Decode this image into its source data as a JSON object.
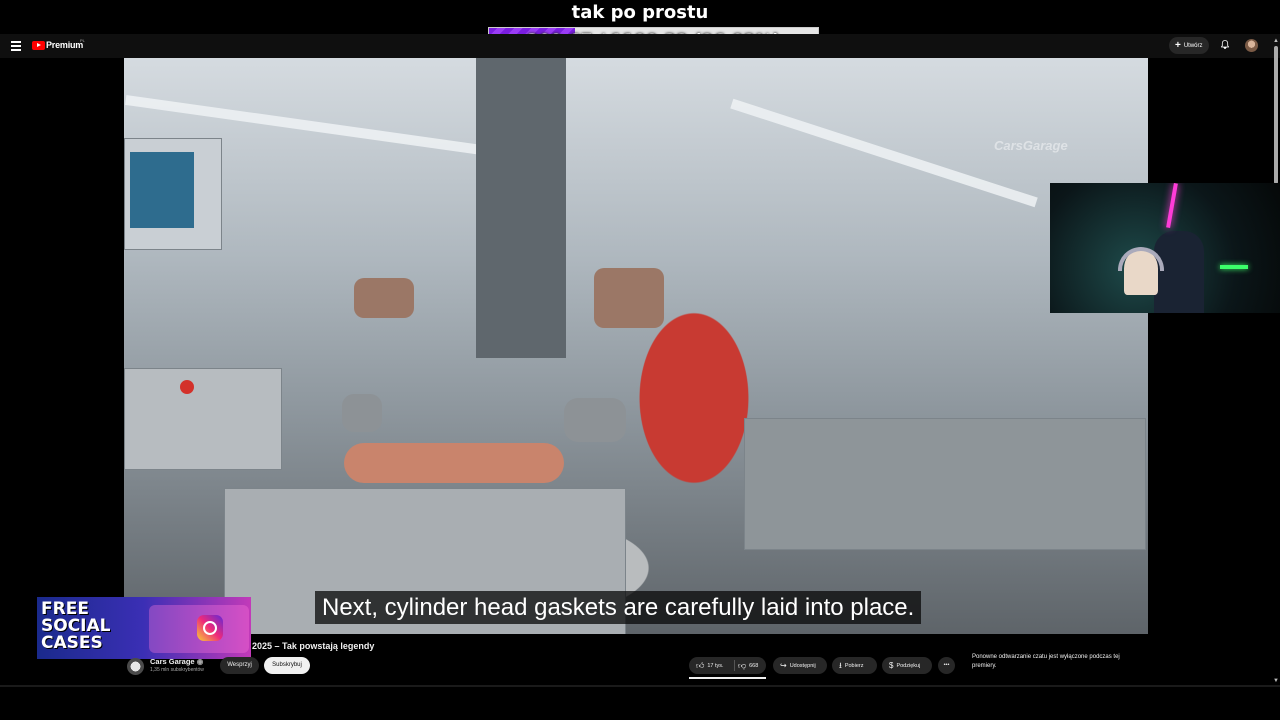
{
  "overlay": {
    "title": "tak po prostu",
    "progress_text": "309.67 / 1190.32 (26.02%)",
    "progress_fraction": 0.2602
  },
  "header": {
    "brand": "Premium",
    "region": "PL",
    "create_label": "Utwórz"
  },
  "video": {
    "subtitle": "Next, cylinder head gaskets are carefully laid into place.",
    "watermark": "CarsGarage"
  },
  "ad": {
    "line1": "FREE",
    "line2": "SOCIAL",
    "line3": "CASES"
  },
  "info": {
    "title": "2025 – Tak powstają legendy",
    "channel_name": "Cars Garage",
    "channel_subs": "1,35 mln subskrybentów",
    "support_label": "Wesprzyj",
    "subscribe_label": "Subskrybuj",
    "likes": "17 tys.",
    "dislikes": "668",
    "share_label": "Udostępnij",
    "download_label": "Pobierz",
    "thanks_label": "Podziękuj",
    "more_label": "•••"
  },
  "chat": {
    "note": "Ponowne odtwarzanie czatu jest wyłączone podczas tej premiery."
  },
  "colors": {
    "progress_fill": "#8a2be2",
    "progress_bg": "#e6e6e6",
    "yt_red": "#ff0000",
    "page_bg": "#000000"
  }
}
